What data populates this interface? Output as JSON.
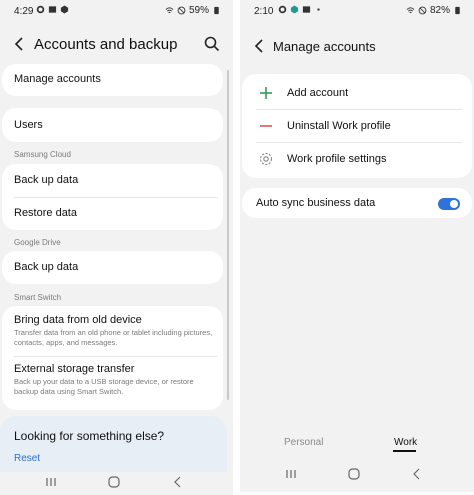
{
  "left": {
    "status": {
      "time": "4:29",
      "battery": "59%"
    },
    "header": {
      "title": "Accounts and backup"
    },
    "items": {
      "manage_accounts": "Manage accounts",
      "users": "Users"
    },
    "sections": {
      "samsung_cloud": "Samsung Cloud",
      "google_drive": "Google Drive",
      "smart_switch": "Smart Switch"
    },
    "samsung_cloud": {
      "back_up": "Back up data",
      "restore": "Restore data"
    },
    "google_drive": {
      "back_up": "Back up data"
    },
    "smart_switch": {
      "bring": {
        "title": "Bring data from old device",
        "desc": "Transfer data from an old phone or tablet including pictures, contacts, apps, and messages."
      },
      "external": {
        "title": "External storage transfer",
        "desc": "Back up your data to a USB storage device, or restore backup data using Smart Switch."
      }
    },
    "suggest": {
      "title": "Looking for something else?",
      "reset": "Reset"
    }
  },
  "right": {
    "status": {
      "time": "2:10",
      "battery": "82%"
    },
    "header": {
      "title": "Manage accounts"
    },
    "items": {
      "add_account": "Add account",
      "uninstall": "Uninstall Work profile",
      "settings": "Work profile settings"
    },
    "auto_sync": {
      "label": "Auto sync business data",
      "enabled": true
    },
    "tabs": {
      "personal": "Personal",
      "work": "Work",
      "selected": "Work"
    }
  },
  "colors": {
    "background": "#f2f2f2",
    "card": "#ffffff",
    "accent": "#2f73d8",
    "add_icon": "#2e9c5a",
    "remove_icon": "#e05555",
    "suggest_bg": "#e7eef6"
  },
  "icons": [
    "back-icon",
    "search-icon",
    "plus-icon",
    "minus-icon",
    "gear-icon",
    "toggle-switch",
    "recents-icon",
    "home-icon",
    "nav-back-icon"
  ]
}
